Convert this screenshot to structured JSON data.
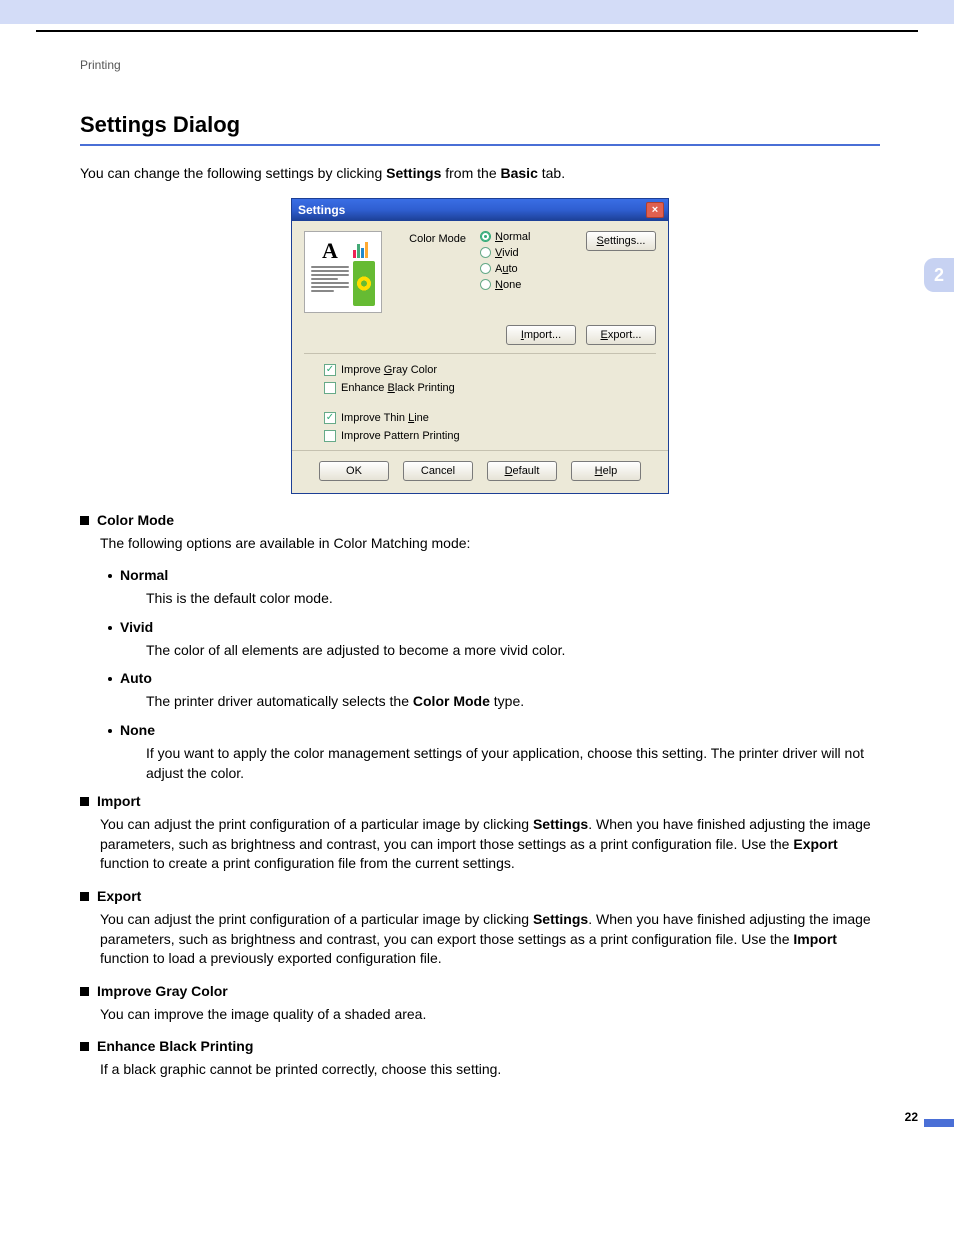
{
  "breadcrumb": "Printing",
  "page_title": "Settings Dialog",
  "intro": {
    "pre": "You can change the following settings by clicking ",
    "b1": "Settings",
    "mid": " from the ",
    "b2": "Basic",
    "post": " tab."
  },
  "side_tab_number": "2",
  "page_number": "22",
  "dialog": {
    "title": "Settings",
    "close": "×",
    "color_mode_label": "Color Mode",
    "radios": {
      "normal": "Normal",
      "vivid": "Vivid",
      "auto": "Auto",
      "none": "None"
    },
    "buttons": {
      "settings": "Settings...",
      "import": "Import...",
      "export": "Export...",
      "ok": "OK",
      "cancel": "Cancel",
      "default": "Default",
      "help": "Help"
    },
    "checks": {
      "improve_gray": "Improve Gray Color",
      "enhance_black": "Enhance Black Printing",
      "improve_thin": "Improve Thin Line",
      "improve_pattern": "Improve Pattern Printing"
    },
    "preview_letter": "A"
  },
  "sections": {
    "color_mode": {
      "heading": "Color Mode",
      "lead": "The following options are available in Color Matching mode:",
      "items": {
        "normal": {
          "title": "Normal",
          "desc": "This is the default color mode."
        },
        "vivid": {
          "title": "Vivid",
          "desc": "The color of all elements are adjusted to become a more vivid color."
        },
        "auto": {
          "title": "Auto",
          "desc_pre": "The printer driver automatically selects the ",
          "desc_bold": "Color Mode",
          "desc_post": " type."
        },
        "none": {
          "title": "None",
          "desc": "If you want to apply the color management settings of your application, choose this setting. The printer driver will not adjust the color."
        }
      }
    },
    "import": {
      "heading": "Import",
      "desc_pre": "You can adjust the print configuration of a particular image by clicking ",
      "b1": "Settings",
      "mid": ". When you have finished adjusting the image parameters, such as brightness and contrast, you can import those settings as a print configuration file. Use the ",
      "b2": "Export",
      "post": " function to create a print configuration file from the current settings."
    },
    "export": {
      "heading": "Export",
      "desc_pre": "You can adjust the print configuration of a particular image by clicking ",
      "b1": "Settings",
      "mid": ". When you have finished adjusting the image parameters, such as brightness and contrast, you can export those settings as a print configuration file. Use the ",
      "b2": "Import",
      "post": " function to load a previously exported configuration file."
    },
    "improve_gray": {
      "heading": "Improve Gray Color",
      "desc": "You can improve the image quality of a shaded area."
    },
    "enhance_black": {
      "heading": "Enhance Black Printing",
      "desc": "If a black graphic cannot be printed correctly, choose this setting."
    }
  }
}
